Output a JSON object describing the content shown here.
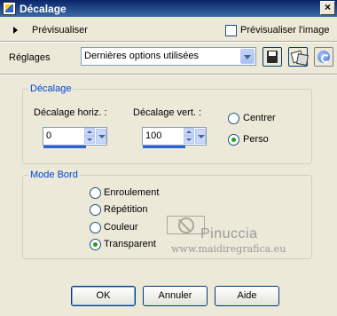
{
  "window": {
    "title": "Décalage",
    "close_glyph": "×"
  },
  "preview": {
    "label": "Prévisualiser",
    "checkbox_label": "Prévisualiser l'image",
    "checked": false
  },
  "settings": {
    "label": "Réglages",
    "preset_value": "Dernières options utilisées"
  },
  "offset_group": {
    "title": "Décalage",
    "horiz_label": "Décalage horiz. :",
    "vert_label": "Décalage vert. :",
    "horiz_value": "0",
    "vert_value": "100",
    "mode_options": [
      {
        "label": "Centrer",
        "selected": false
      },
      {
        "label": "Perso",
        "selected": true
      }
    ]
  },
  "edge_group": {
    "title": "Mode Bord",
    "options": [
      {
        "label": "Enroulement",
        "selected": false
      },
      {
        "label": "Répétition",
        "selected": false
      },
      {
        "label": "Couleur",
        "selected": false
      },
      {
        "label": "Transparent",
        "selected": true
      }
    ]
  },
  "watermark": {
    "name": "Pinuccia",
    "url": "www.maidiregrafica.eu"
  },
  "buttons": {
    "ok": "OK",
    "cancel": "Annuler",
    "help": "Aide"
  },
  "colors": {
    "titlebar": "#0a246a",
    "accent_radio": "#21a121",
    "group_title": "#0046d5"
  }
}
